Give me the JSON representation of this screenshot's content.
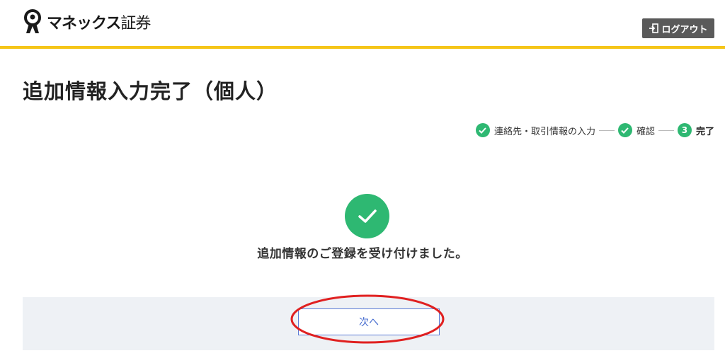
{
  "header": {
    "logo_text": "マネックス",
    "logo_text2": "証券",
    "logout_label": "ログアウト",
    "accent_color": "#f5c518"
  },
  "page": {
    "title": "追加情報入力完了（個人）"
  },
  "stepper": {
    "steps": [
      {
        "number": "",
        "label": "連絡先・取引情報の入力",
        "state": "done"
      },
      {
        "number": "",
        "label": "確認",
        "state": "done"
      },
      {
        "number": "3",
        "label": "完了",
        "state": "current"
      }
    ],
    "color": "#2eb872"
  },
  "result": {
    "icon": "check-circle-icon",
    "message": "追加情報のご登録を受け付けました。"
  },
  "actions": {
    "next_label": "次へ"
  }
}
